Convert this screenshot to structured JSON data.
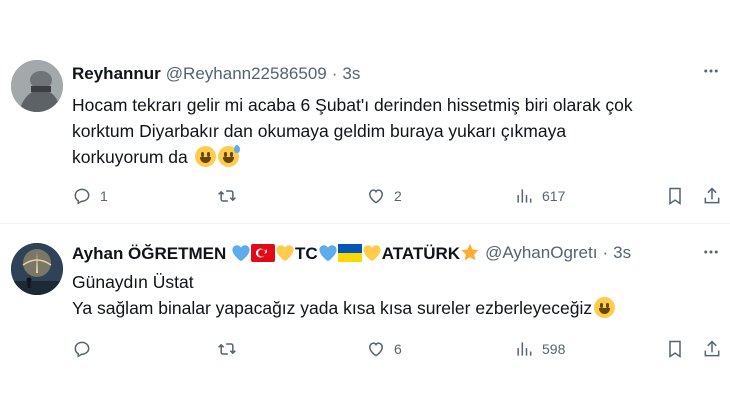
{
  "tweets": [
    {
      "name": "Reyhannur",
      "handle": "@Reyhann22586509",
      "time": "3s",
      "lines": [
        "Hocam tekrarı gelir mi acaba 6 Şubat'ı derinden hissetmiş biri olarak çok",
        "korktum Diyarbakır dan okumaya geldim buraya yukarı çıkmaya",
        "korkuyorum da"
      ],
      "replies": "1",
      "retweets": "",
      "likes": "2",
      "views": "617"
    },
    {
      "name_part1": "Ayhan ÖĞRETMEN",
      "name_tc": "TC",
      "name_ataturk": "ATATÜRK",
      "handle": "@AyhanOgretı",
      "time": "3s",
      "lines": [
        "Günaydın Üstat",
        "Ya sağlam binalar yapacağız yada kısa kısa sureler ezberleyeceğiz"
      ],
      "replies": "",
      "retweets": "",
      "likes": "6",
      "views": "598"
    }
  ],
  "colors": {
    "text": "#0f1419",
    "secondary": "#536471",
    "divider": "#eff3f4",
    "heart_blue": "#5dadec",
    "heart_yellow": "#ffcc4d",
    "turkey_red": "#e30a17",
    "ukraine_blue": "#0057b7",
    "ukraine_yellow": "#ffd700"
  },
  "icons": [
    "more-icon",
    "reply-icon",
    "retweet-icon",
    "like-icon",
    "views-icon",
    "bookmark-icon",
    "share-icon",
    "grinning-emoji",
    "sweat-smile-emoji",
    "blue-heart-emoji",
    "yellow-heart-emoji",
    "turkey-flag-emoji",
    "ukraine-flag-emoji",
    "star-emoji"
  ]
}
